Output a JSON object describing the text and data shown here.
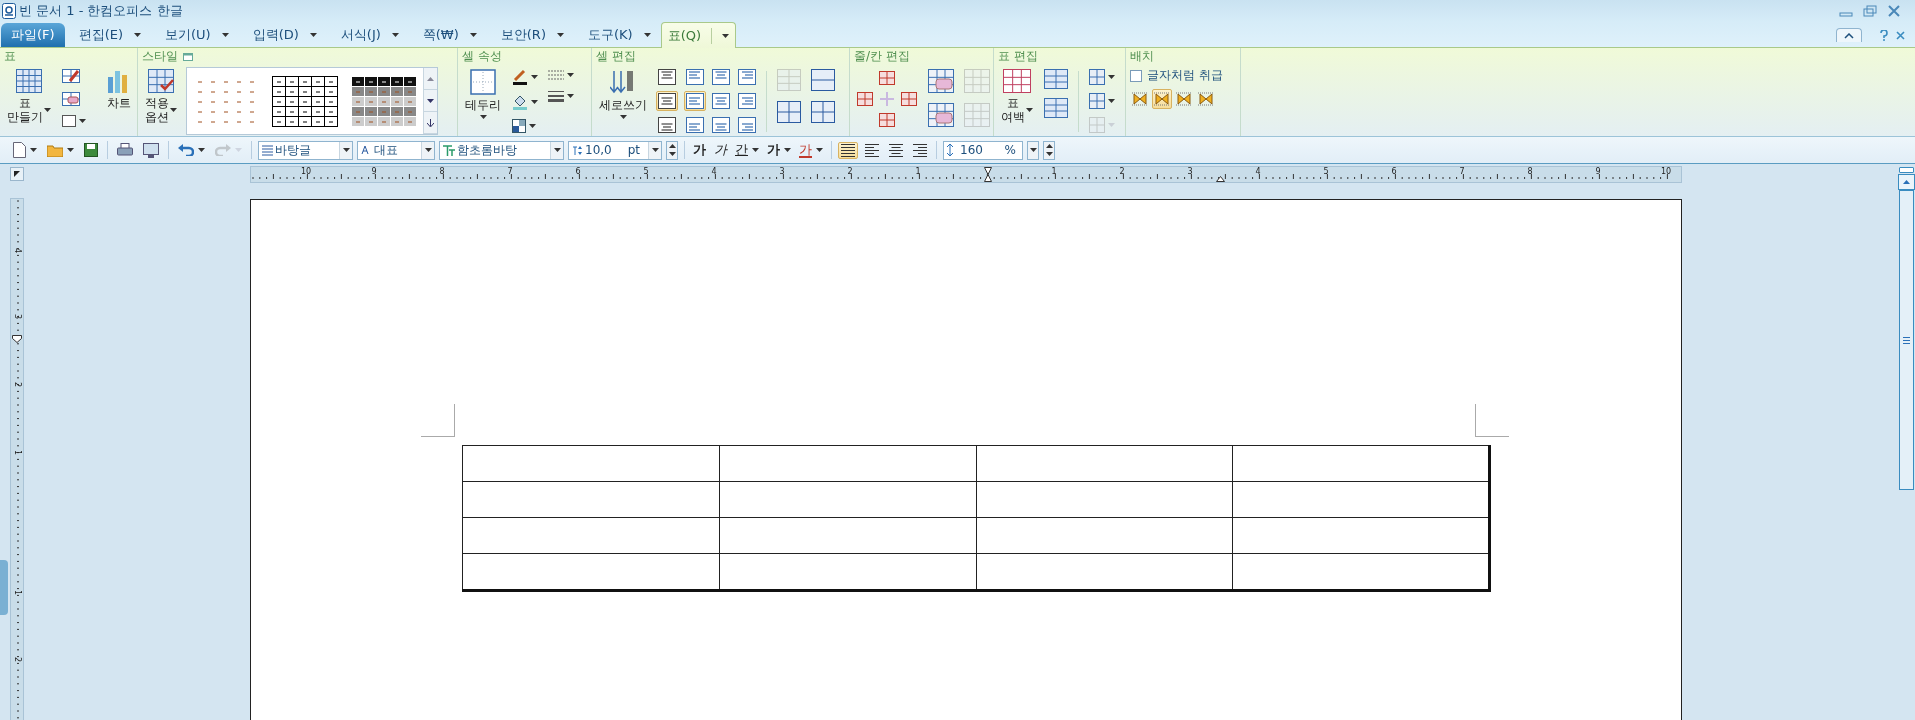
{
  "window": {
    "title": "빈 문서 1 - 한컴오피스 한글"
  },
  "menu_tabs": [
    {
      "label": "파일(F)",
      "kind": "file",
      "selected": false
    },
    {
      "label": "편집(E)",
      "kind": "menu",
      "selected": false
    },
    {
      "label": "보기(U)",
      "kind": "menu",
      "selected": false
    },
    {
      "label": "입력(D)",
      "kind": "menu",
      "selected": false
    },
    {
      "label": "서식(J)",
      "kind": "menu",
      "selected": false
    },
    {
      "label": "쪽(₩)",
      "kind": "menu",
      "selected": false
    },
    {
      "label": "보안(R)",
      "kind": "menu",
      "selected": false
    },
    {
      "label": "도구(K)",
      "kind": "menu",
      "selected": false
    },
    {
      "label": "표(Q)",
      "kind": "menu",
      "selected": true
    }
  ],
  "ribbon_groups": [
    {
      "kind": "table",
      "title": "표",
      "buttons": [
        {
          "label": "표\n만들기"
        },
        {
          "label": "차트"
        }
      ]
    },
    {
      "kind": "style",
      "title": "스타일",
      "buttons": [
        {
          "label": "적용\n옵션"
        }
      ]
    },
    {
      "kind": "cell_props",
      "title": "셀 속성",
      "buttons": [
        {
          "label": "테두리"
        }
      ]
    },
    {
      "kind": "cell_edit",
      "title": "셀 편집",
      "buttons": [
        {
          "label": "세로쓰기"
        }
      ],
      "vertical_align": [
        {
          "selected": false
        },
        {
          "selected": true
        },
        {
          "selected": false
        }
      ],
      "alignment": [
        {
          "selected": false
        },
        {
          "selected": false
        },
        {
          "selected": false
        },
        {
          "selected": true
        },
        {
          "selected": false
        },
        {
          "selected": false
        },
        {
          "selected": false
        },
        {
          "selected": false
        },
        {
          "selected": false
        }
      ],
      "merge_split": [
        {
          "disabled": true
        },
        {
          "disabled": false
        },
        {
          "disabled": false
        },
        {
          "disabled": false
        }
      ]
    },
    {
      "kind": "row_col",
      "title": "줄/칸 편집",
      "delete": [
        {
          "disabled": false
        },
        {
          "disabled": true
        },
        {
          "disabled": false
        },
        {
          "disabled": true
        }
      ]
    },
    {
      "kind": "table_edit",
      "title": "표 편집",
      "buttons": [
        {
          "label": "표\n여백"
        }
      ],
      "tools": [
        {
          "disabled": false
        },
        {
          "disabled": false
        },
        {
          "disabled": true
        }
      ]
    },
    {
      "kind": "layout",
      "title": "배치",
      "checkbox": {
        "label": "글자처럼 취급",
        "checked": false
      },
      "wrap": [
        {
          "selected": false
        },
        {
          "selected": true
        },
        {
          "selected": false
        },
        {
          "selected": false
        }
      ]
    }
  ],
  "toolbar": {
    "redo": {
      "disabled": true
    },
    "style": "바탕글",
    "char_style": "대표",
    "font": "함초롬바탕",
    "size": "10,0",
    "size_unit": "pt",
    "format_buttons": [
      {
        "label": "가",
        "kind": "bold"
      },
      {
        "label": "가",
        "kind": "italic"
      },
      {
        "label": "간",
        "kind": "underline"
      },
      {
        "label": "가",
        "kind": "outline"
      },
      {
        "label": "가",
        "kind": "color"
      }
    ],
    "align": [
      {
        "selected": true
      },
      {
        "selected": false
      },
      {
        "selected": false
      },
      {
        "selected": false
      }
    ],
    "line_spacing": "160",
    "line_spacing_unit": "%"
  },
  "ruler": {
    "labels": [
      "10",
      "9",
      "8",
      "7",
      "6",
      "5",
      "4",
      "3",
      "2",
      "1",
      "1",
      "2",
      "3",
      "4",
      "5",
      "6",
      "7",
      "8",
      "9",
      "10"
    ]
  },
  "vertical_ruler": {
    "labels": [
      "4",
      "3",
      "2",
      "1",
      "1",
      "2"
    ]
  },
  "table": {
    "rows": [
      {
        "cells": [
          {
            "kind": "empty"
          },
          {
            "kind": "empty"
          },
          {
            "kind": "empty"
          },
          {
            "kind": "empty"
          }
        ]
      },
      {
        "cells": [
          {
            "kind": "empty"
          },
          {
            "kind": "empty"
          },
          {
            "kind": "empty"
          },
          {
            "kind": "empty"
          }
        ]
      },
      {
        "cells": [
          {
            "kind": "empty"
          },
          {
            "kind": "empty"
          },
          {
            "kind": "empty"
          },
          {
            "kind": "empty"
          }
        ]
      },
      {
        "cells": [
          {
            "kind": "empty"
          },
          {
            "kind": "empty"
          },
          {
            "kind": "empty"
          },
          {
            "kind": "empty"
          }
        ]
      }
    ]
  }
}
